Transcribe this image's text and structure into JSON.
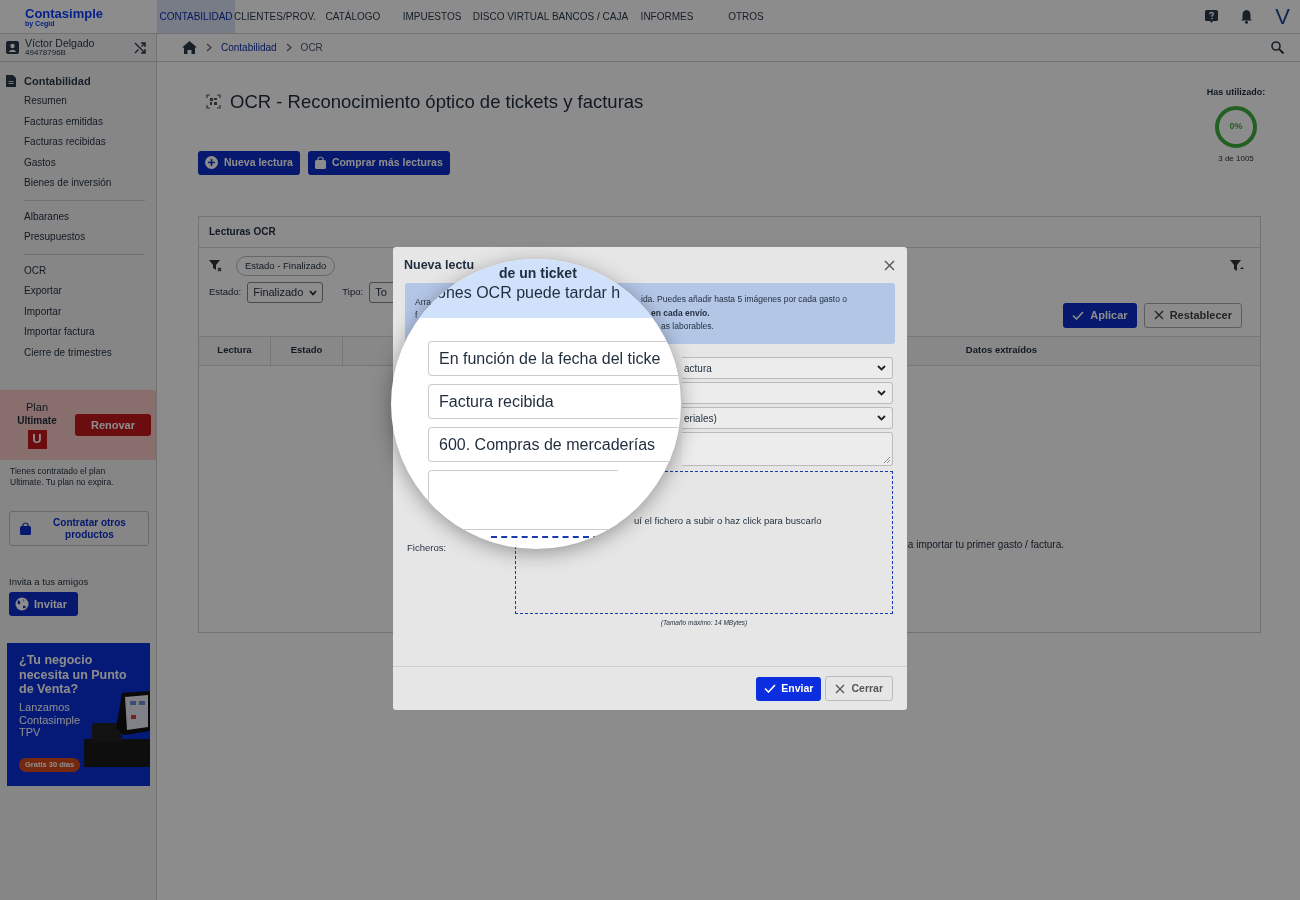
{
  "app": {
    "logo": "Contasimple",
    "logo_sub": "by Cegid",
    "avatar": "V"
  },
  "nav": [
    {
      "label": "CONTABILIDAD",
      "selected": true
    },
    {
      "label": "CLIENTES/PROV.",
      "selected": false
    },
    {
      "label": "CATÁLOGO",
      "selected": false
    },
    {
      "label": "IMPUESTOS",
      "selected": false
    },
    {
      "label": "DISCO VIRTUAL",
      "selected": false
    },
    {
      "label": "BANCOS / CAJA",
      "selected": false
    },
    {
      "label": "INFORMES",
      "selected": false
    },
    {
      "label": "OTROS",
      "selected": false
    }
  ],
  "user": {
    "name": "Víctor Delgado",
    "id": "49478796B"
  },
  "breadcrumb": [
    "Contabilidad",
    "OCR"
  ],
  "sidebar": {
    "section": "Contabilidad",
    "groups": [
      [
        "Resumen",
        "Facturas emitidas",
        "Facturas recibidas",
        "Gastos",
        "Bienes de inversión"
      ],
      [
        "Albaranes",
        "Presupuestos"
      ],
      [
        "OCR",
        "Exportar",
        "Importar",
        "Importar factura",
        "Cierre de trimestres"
      ]
    ]
  },
  "plan": {
    "label": "Plan",
    "name": "Ultimate",
    "badge": "U",
    "button": "Renovar",
    "note": "Tienes contratado el plan Ultimate. Tu plan no expira."
  },
  "other_products": "Contratar otros productos",
  "invite": {
    "label": "Invita a tus amigos",
    "button": "Invitar"
  },
  "ad": {
    "headline": "¿Tu negocio necesita un Punto de Venta?",
    "text": "Lanzamos Contasimple TPV",
    "cta": "Gratis 30 días"
  },
  "page": {
    "title": "OCR - Reconocimiento óptico de tickets y facturas",
    "buttons": [
      {
        "kind": "add",
        "label": "Nueva lectura"
      },
      {
        "kind": "bag",
        "label": "Comprar más lecturas"
      }
    ],
    "usage": {
      "label": "Has utilizado:",
      "percent": "0%",
      "count": "3 de 1005"
    }
  },
  "panel": {
    "title": "Lecturas OCR",
    "chip": "Estado - Finalizado",
    "filters": [
      {
        "label": "Estado:",
        "value": "Finalizado"
      },
      {
        "label": "Tipo:",
        "value": "To"
      }
    ],
    "apply": "Aplicar",
    "reset": "Restablecer",
    "columns": [
      "Lectura",
      "Estado",
      "Datos extraídos"
    ],
    "empty": "a importar tu primer gasto / factura."
  },
  "dialog": {
    "title": "Nueva lectu",
    "info": [
      {
        "left": "Arra",
        "right": "ida. Puedes añadir hasta 5 imágenes por cada gasto o",
        "bold": false
      },
      {
        "left": "f",
        "right": "en cada envío.",
        "bold": true
      },
      {
        "right": "as laborables.",
        "bold": false
      }
    ],
    "rows": [
      {
        "kind": "select",
        "value": "actura"
      },
      {
        "kind": "select"
      },
      {
        "kind": "select",
        "value": "eriales)"
      },
      {
        "kind": "textarea"
      }
    ],
    "files_label": "Ficheros:",
    "drop_text": "uí el fichero a subir o haz click para buscarlo",
    "size_note": "(Tamaño máximo: 14 MBytes)",
    "buttons": [
      {
        "kind": "primary",
        "label": "Enviar"
      },
      {
        "kind": "secondary",
        "label": "Cerrar"
      }
    ]
  },
  "magnifier": {
    "title": "de un ticket",
    "info": "ones OCR puede tardar h",
    "fields": [
      {
        "kind": "input",
        "value": "En función de la fecha del ticke"
      },
      {
        "kind": "input",
        "value": "Factura recibida"
      },
      {
        "kind": "input",
        "value": "600. Compras de mercaderías"
      },
      {
        "kind": "textarea"
      }
    ]
  }
}
